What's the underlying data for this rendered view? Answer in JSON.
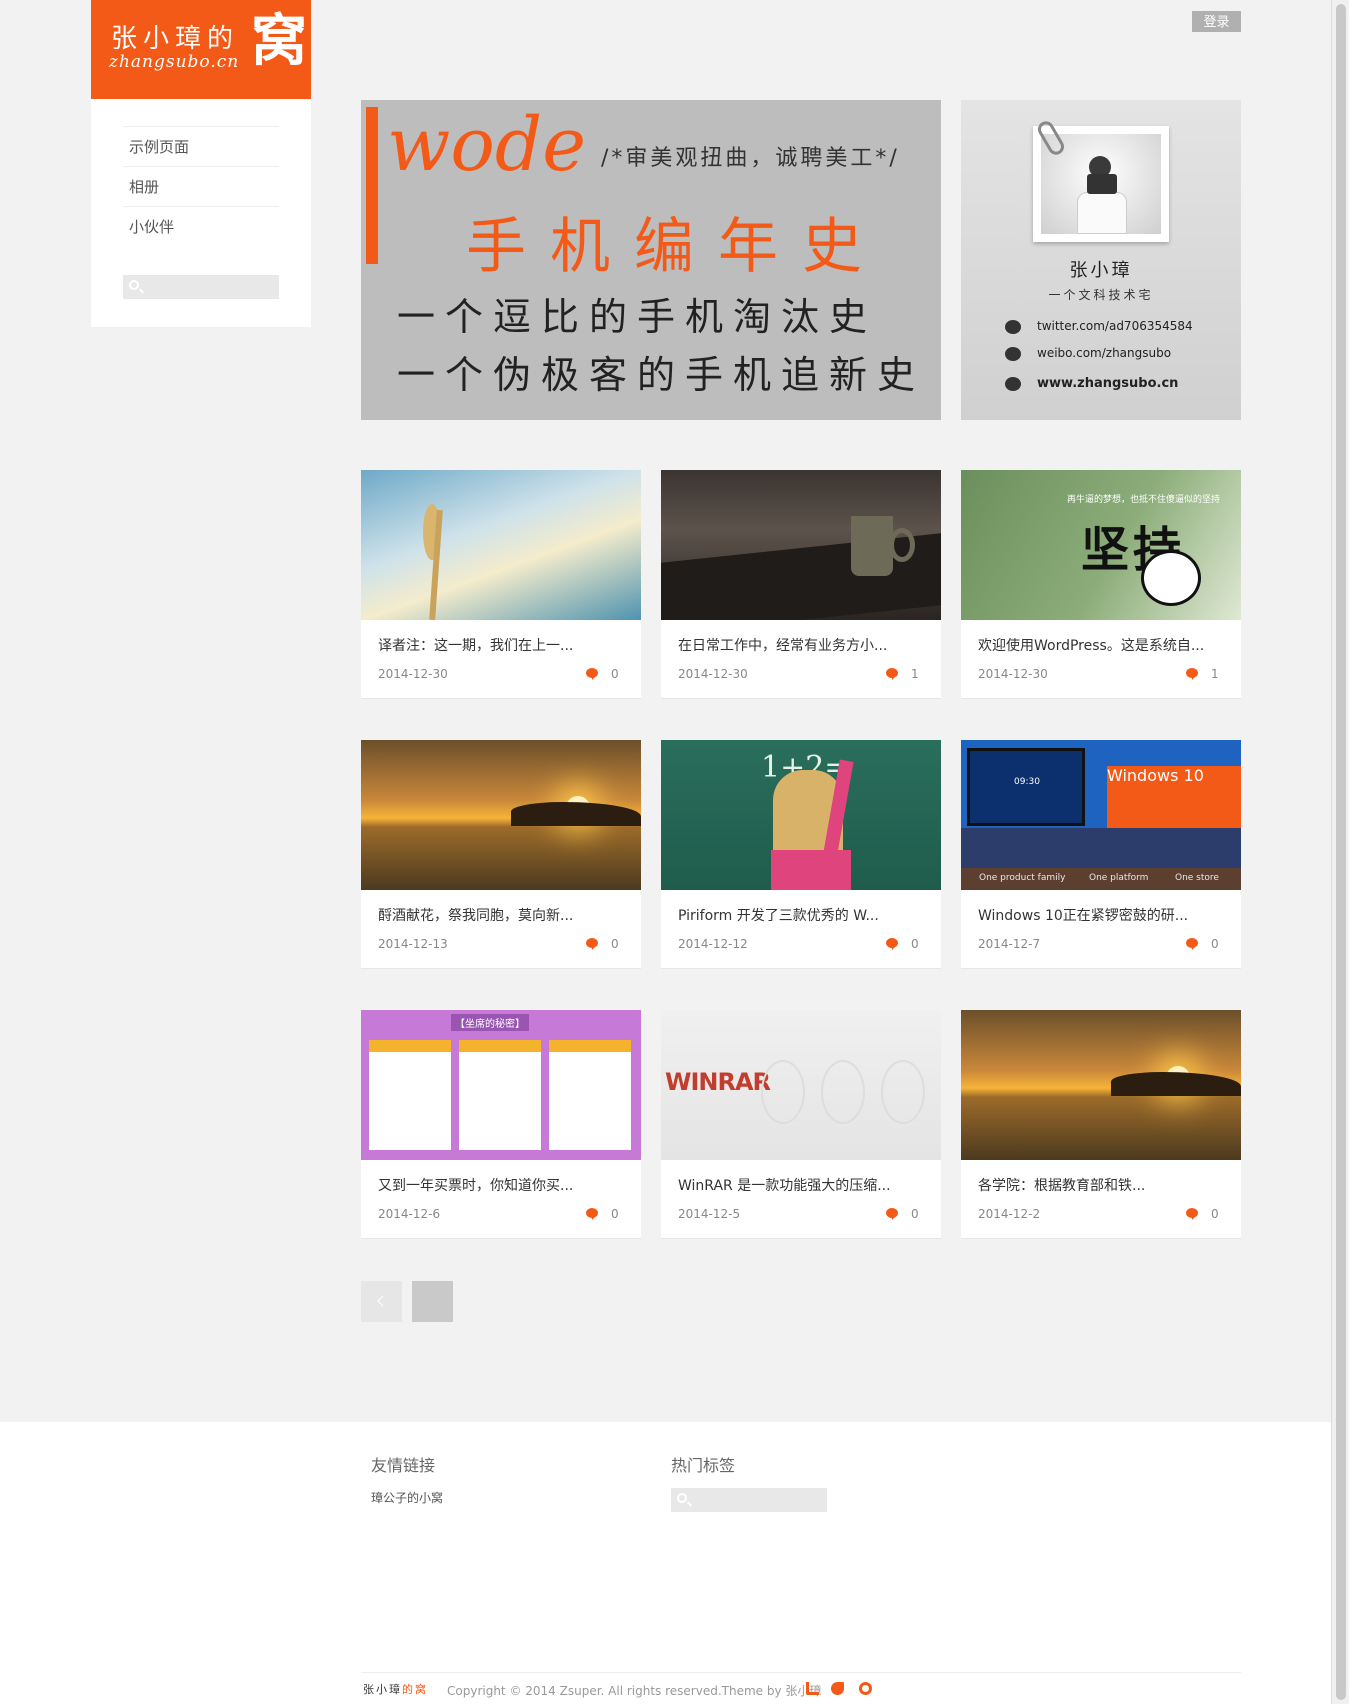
{
  "site": {
    "logo_line1": "张小璋的",
    "logo_line2": "zhangsubo.cn",
    "logo_big": "窝"
  },
  "colors": {
    "accent": "#f45a17",
    "background": "#f2f2f2"
  },
  "sidebar": {
    "nav": [
      {
        "label": "示例页面"
      },
      {
        "label": "相册"
      },
      {
        "label": "小伙伴"
      }
    ],
    "search_icon": "search-icon"
  },
  "header": {
    "login_label": "登录"
  },
  "hero": {
    "wode": "wode",
    "note": "/*审美观扭曲，诚聘美工*/",
    "title": "手机编年史",
    "line1": "一个逗比的手机淘汰史",
    "line2": "一个伪极客的手机追新史"
  },
  "profile": {
    "name": "张小璋",
    "subtitle": "一个文科技术宅",
    "twitter": "twitter.com/ad706354584",
    "weibo": "weibo.com/zhangsubo",
    "website": "www.zhangsubo.cn"
  },
  "posts": [
    {
      "title": "译者注：这一期，我们在上一...",
      "date": "2014-12-30",
      "comments": "0",
      "thumb": "sky"
    },
    {
      "title": "在日常工作中，经常有业务方小...",
      "date": "2014-12-30",
      "comments": "1",
      "thumb": "coffee"
    },
    {
      "title": "欢迎使用WordPress。这是系统自...",
      "date": "2014-12-30",
      "comments": "1",
      "thumb": "green"
    },
    {
      "title": "酹酒献花，祭我同胞，莫向新...",
      "date": "2014-12-13",
      "comments": "0",
      "thumb": "sunset"
    },
    {
      "title": "Piriform 开发了三款优秀的 W...",
      "date": "2014-12-12",
      "comments": "0",
      "thumb": "board"
    },
    {
      "title": "Windows 10正在紧锣密鼓的研...",
      "date": "2014-12-7",
      "comments": "0",
      "thumb": "win"
    },
    {
      "title": "又到一年买票时，你知道你买...",
      "date": "2014-12-6",
      "comments": "0",
      "thumb": "ticket"
    },
    {
      "title": "WinRAR 是一款功能强大的压缩...",
      "date": "2014-12-5",
      "comments": "0",
      "thumb": "winrar"
    },
    {
      "title": "各学院：根据教育部和铁...",
      "date": "2014-12-2",
      "comments": "0",
      "thumb": "sunset"
    }
  ],
  "thumb_text": {
    "green_caption": "再牛逼的梦想，也抵不住傻逼似的坚持",
    "green_big": "坚持",
    "board_math": "1+2=",
    "win_logo": "Windows 10",
    "win_screen": "09:30",
    "win_foot": [
      "One product family",
      "One platform",
      "One store"
    ],
    "ticket_header": "【坐席的秘密】",
    "winrar_logo": "WINRAR"
  },
  "pagination": {
    "prev_icon": "chevron-left-icon"
  },
  "footer": {
    "links_heading": "友情链接",
    "tags_heading": "热门标签",
    "link1": "璋公子的小窝",
    "logo_main": "张小璋",
    "logo_accent": "的窝",
    "copyright": "Copyright © 2014 Zsuper. All rights reserved.Theme by 张小璋",
    "social_icons": [
      "rss-icon",
      "twitter-icon",
      "weibo-icon"
    ]
  }
}
